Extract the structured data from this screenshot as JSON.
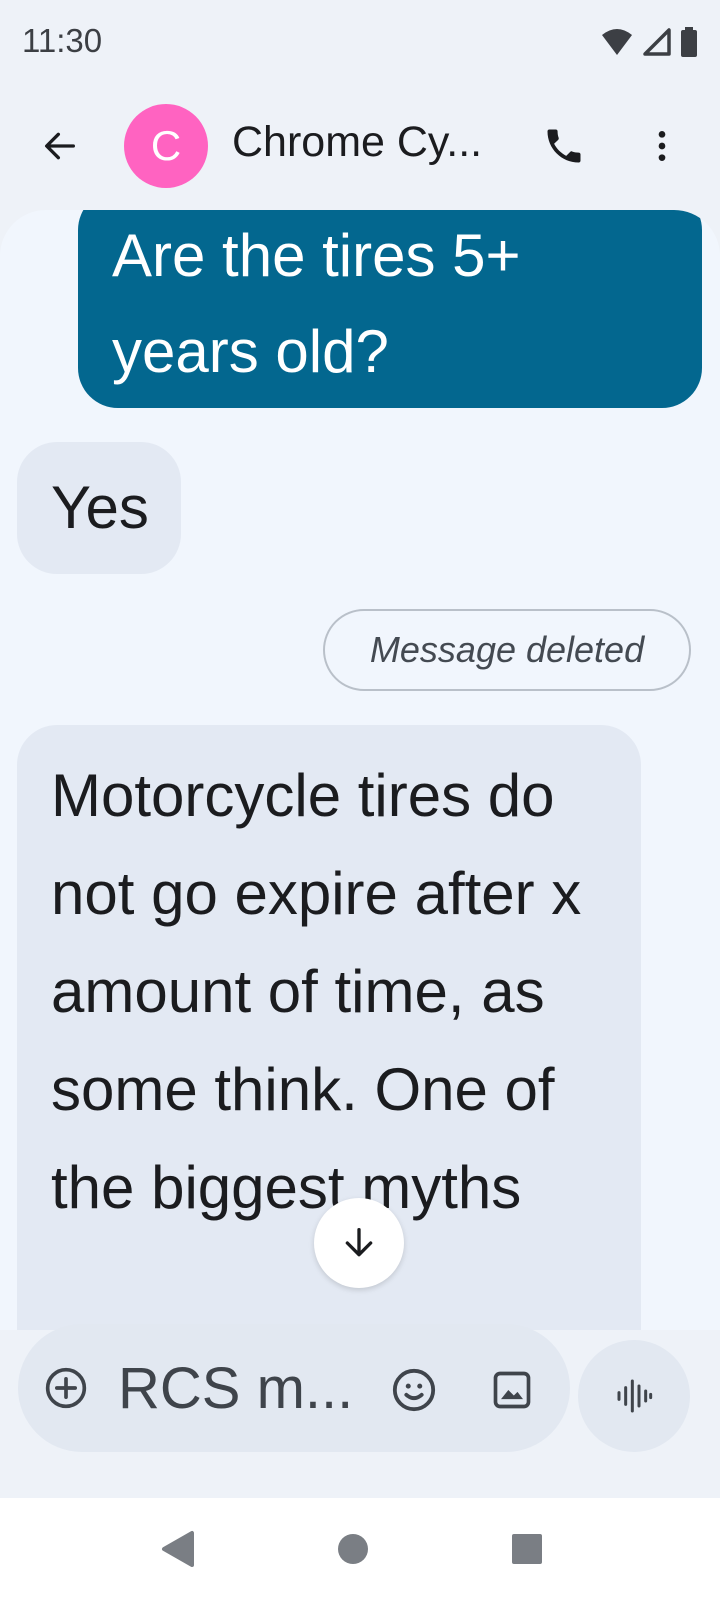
{
  "status_bar": {
    "time": "11:30"
  },
  "header": {
    "avatar_letter": "C",
    "contact_name": "Chrome Cy...",
    "avatar_color": "#ff63c1"
  },
  "messages": [
    {
      "direction": "outgoing",
      "text": "Are the tires 5+ years old?"
    },
    {
      "direction": "incoming",
      "text": "Yes"
    },
    {
      "direction": "outgoing",
      "status": "Message deleted"
    },
    {
      "direction": "incoming",
      "text": "Motorcycle tires do not go expire after x amount of time, as some think. One of the biggest myths"
    }
  ],
  "compose": {
    "placeholder": "RCS m..."
  },
  "colors": {
    "outgoing_bubble": "#03678f",
    "incoming_bubble": "#e3e9f3",
    "background": "#f1f6fd"
  },
  "icons": {
    "back": "arrow-left-icon",
    "call": "phone-icon",
    "more": "more-vertical-icon",
    "scroll": "arrow-down-icon",
    "attach": "add-circle-icon",
    "emoji": "emoji-icon",
    "gallery": "image-icon",
    "voice": "waveform-icon"
  }
}
